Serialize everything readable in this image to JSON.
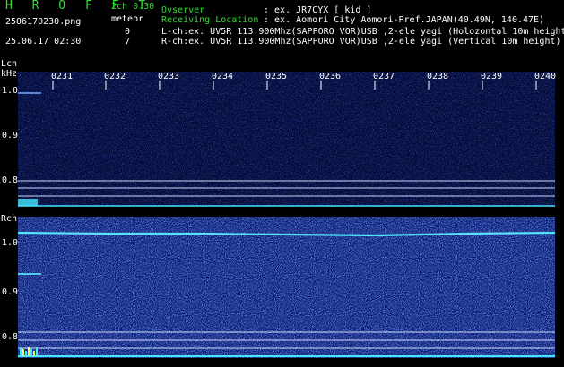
{
  "header": {
    "brand": "H R O F F T",
    "channel_version": "2ch 0.30",
    "meteor_label": "meteor",
    "filename": "2506170230.png",
    "timestamp": "25.06.17 02:30",
    "l_count": "0",
    "r_count": "7"
  },
  "info": {
    "observer_label": "Ovserver",
    "observer_value": ": ex. JR7CYX [ kid ]",
    "location_label": "Receiving Location",
    "location_value": ": ex. Aomori City Aomori-Pref.JAPAN(40.49N, 140.47E)",
    "lch": "L-ch:ex. UV5R 113.900Mhz(SAPPORO VOR)USB ,2-ele yagi (Holozontal 10m height",
    "rch": "R-ch:ex. UV5R 113.900Mhz(SAPPORO VOR)USB ,2-ele yagi (Vertical 10m height)"
  },
  "spectrogram": {
    "l_channel_label": "Lch",
    "unit_label": "kHz",
    "r_channel_label": "Rch",
    "time_ticks": [
      "0231",
      "0232",
      "0233",
      "0234",
      "0235",
      "0236",
      "0237",
      "0238",
      "0239",
      "0240"
    ],
    "l_freq_ticks": [
      "1.0",
      "0.9",
      "0.8"
    ],
    "r_freq_ticks": [
      "1.0",
      "0.9",
      "0.8"
    ]
  },
  "colors": {
    "background": "#000000",
    "noise_blue": "#1c2f9a",
    "signal_cyan": "#45e6ff",
    "label_green": "#2fe02f"
  }
}
